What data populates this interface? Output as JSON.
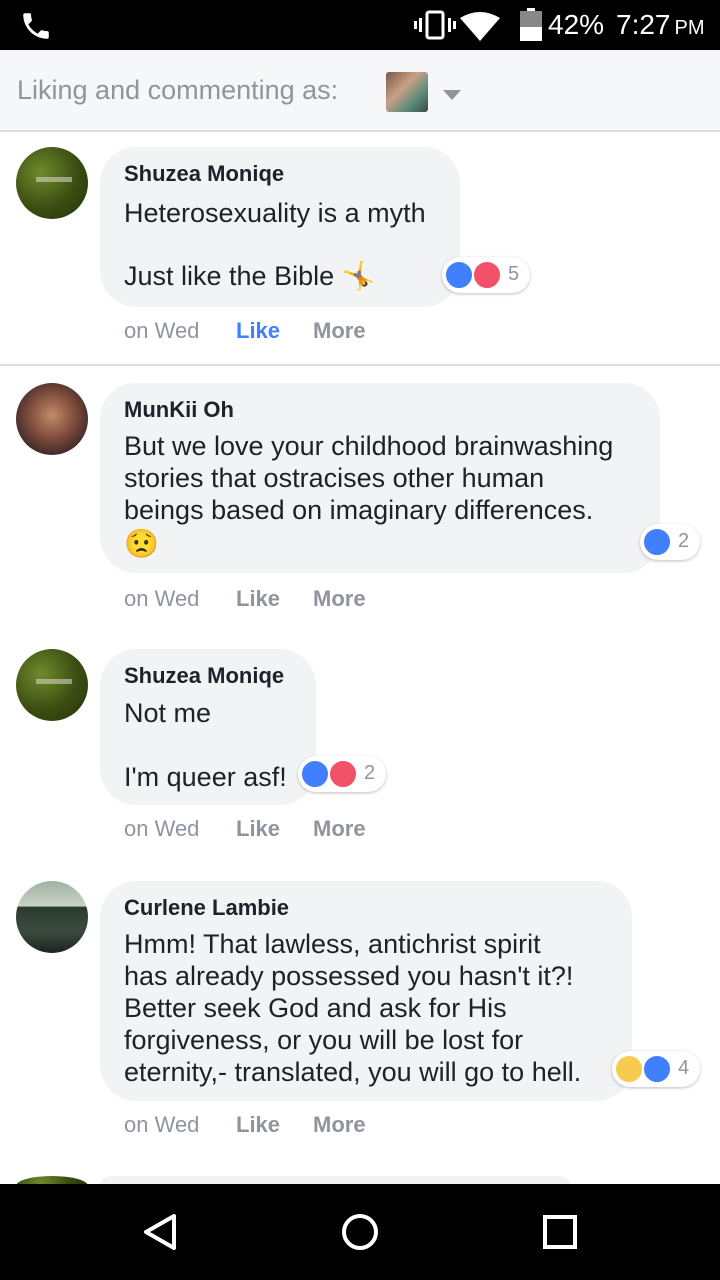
{
  "status_bar": {
    "battery_percent": "42%",
    "time": "7:27",
    "ampm": "PM",
    "icons": [
      "phone-icon",
      "vibrate-icon",
      "wifi-icon",
      "battery-icon"
    ]
  },
  "liking_bar": {
    "label": "Liking and commenting as:"
  },
  "comments": [
    {
      "author": "Shuzea Moniqe",
      "line1": "Heterosexuality is a myth",
      "line2": "Just like the Bible 🤸",
      "reaction_count": "5",
      "reactions": [
        "like",
        "love"
      ],
      "time": "on Wed",
      "like": "Like",
      "more": "More",
      "liked": true
    },
    {
      "author": "MunKii Oh",
      "text": "But we love your childhood brainwashing\nstories that ostracises other human\nbeings based on imaginary differences.",
      "emoji": "😟",
      "reaction_count": "2",
      "reactions": [
        "like"
      ],
      "time": "on Wed",
      "like": "Like",
      "more": "More"
    },
    {
      "author": "Shuzea Moniqe",
      "line1": "Not me",
      "line2": "I'm queer asf!",
      "reaction_count": "2",
      "reactions": [
        "like",
        "love"
      ],
      "time": "on Wed",
      "like": "Like",
      "more": "More"
    },
    {
      "author": "Curlene Lambie",
      "text": "Hmm! That lawless, antichrist spirit\nhas already possessed you hasn't it?!\nBetter seek God and ask for His\nforgiveness, or you will be lost for\neternity,- translated, you will go to hell.",
      "reaction_count": "4",
      "reactions": [
        "haha",
        "like"
      ],
      "time": "on Wed",
      "like": "Like",
      "more": "More"
    }
  ],
  "nav_bar": {
    "icons": [
      "back-icon",
      "home-icon",
      "recents-icon"
    ]
  },
  "colors": {
    "facebook_blue": "#4080ff",
    "love_red": "#f25268",
    "bubble_gray": "#f2f3f5",
    "meta_gray": "#90949c"
  }
}
